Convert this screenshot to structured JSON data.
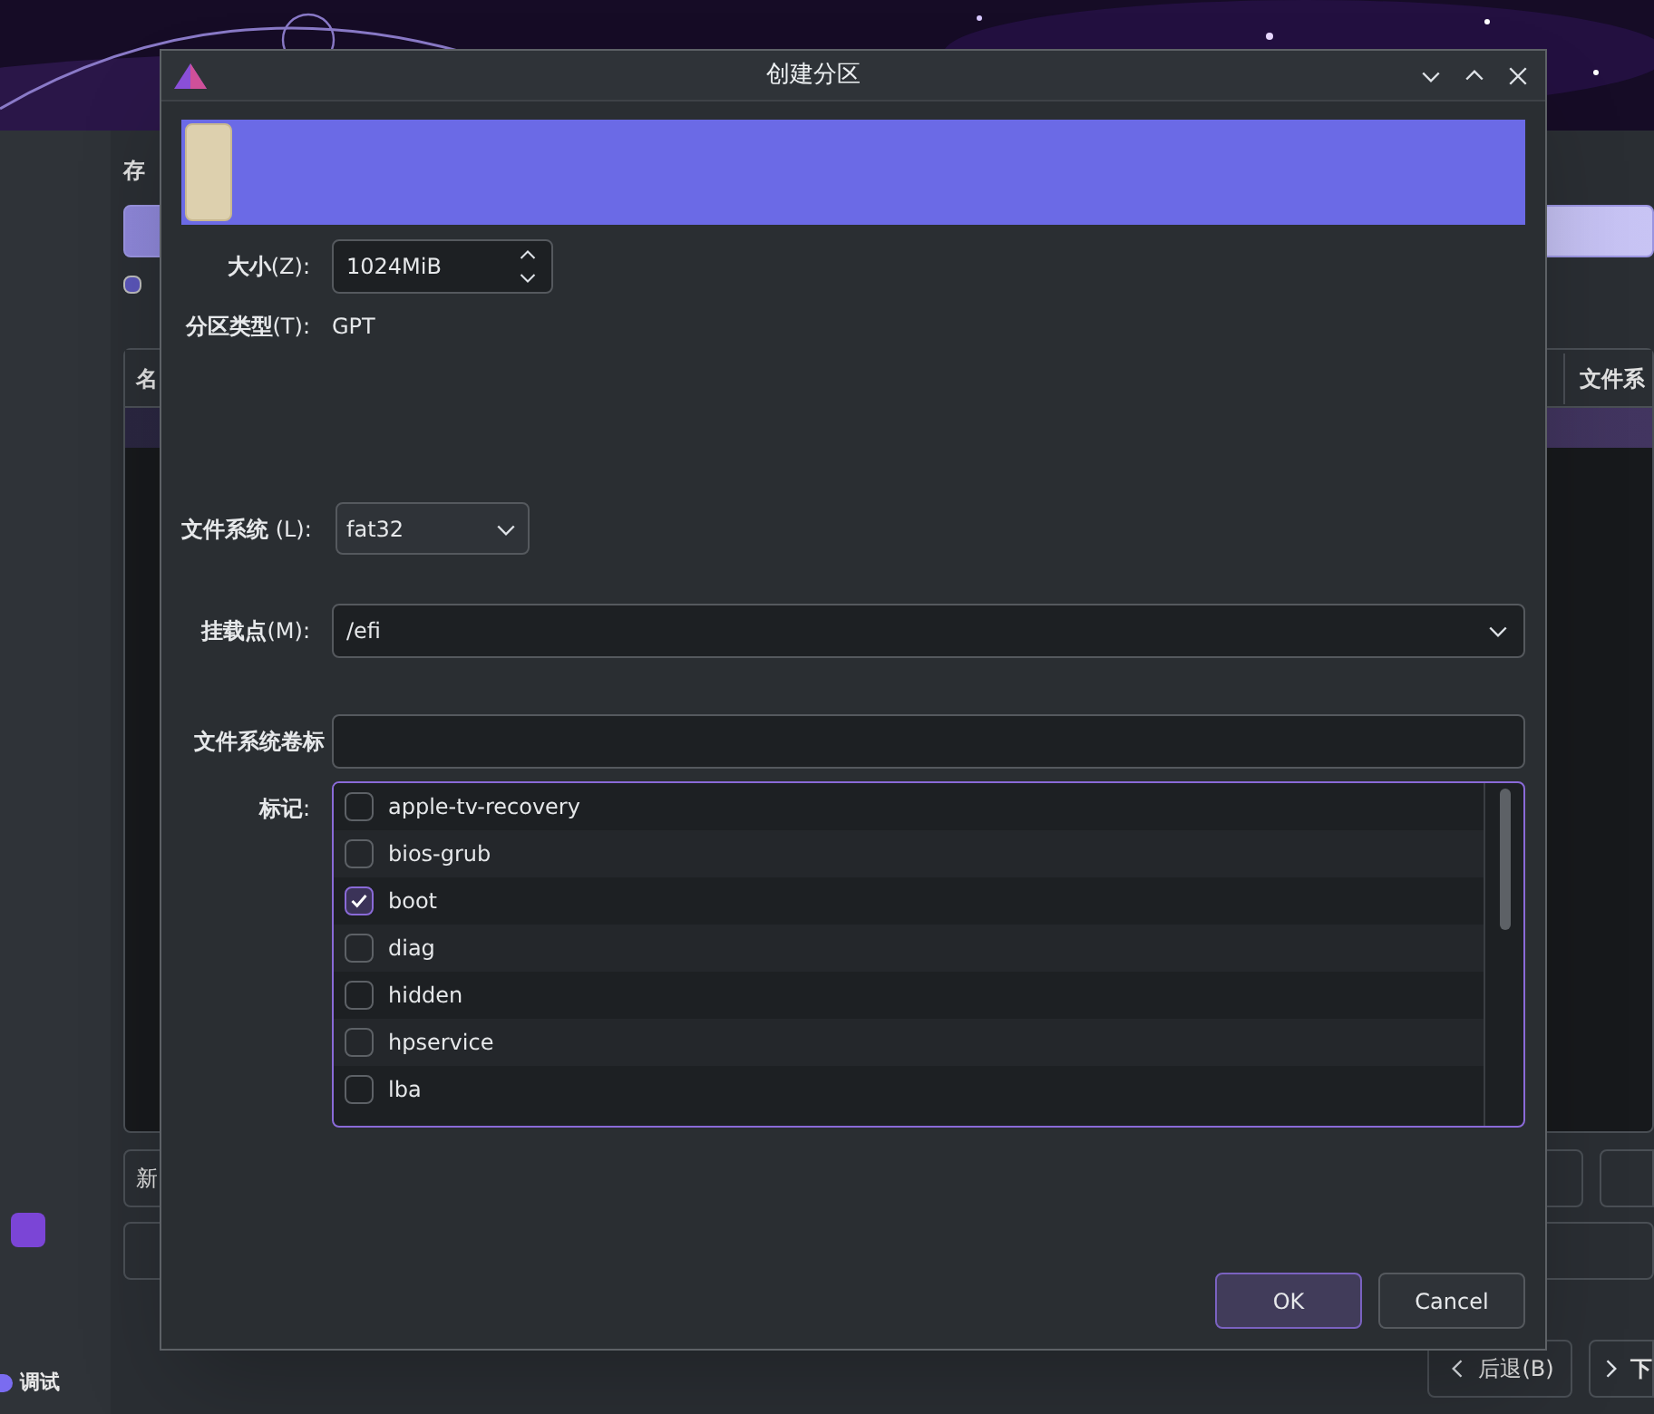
{
  "background_app": {
    "section_label": "存",
    "option_checked": true,
    "table": {
      "columns": [
        "名",
        "文件系"
      ]
    },
    "left_button": "新",
    "back_button": "后退(B)",
    "next_button": "下",
    "sidebar_item": "调试"
  },
  "dialog": {
    "title": "创建分区",
    "partition_bar": {
      "level": 0.035
    },
    "size": {
      "label": "**大小**(Z):",
      "value": "1024MiB"
    },
    "partition_type": {
      "label": "**分区类型**(T):",
      "value": "GPT"
    },
    "file_system": {
      "label": "**文件系统** (L):",
      "value": "fat32"
    },
    "mount_point": {
      "label": "**挂载点**(M):",
      "value": "/efi"
    },
    "volume_label": {
      "label": "**文件系统卷标**"
    },
    "flags": {
      "label": "**标记**:",
      "items": [
        {
          "label": "apple-tv-recovery",
          "checked": false
        },
        {
          "label": "bios-grub",
          "checked": false
        },
        {
          "label": "boot",
          "checked": true
        },
        {
          "label": "diag",
          "checked": false
        },
        {
          "label": "hidden",
          "checked": false
        },
        {
          "label": "hpservice",
          "checked": false
        },
        {
          "label": "lba",
          "checked": false
        }
      ]
    },
    "buttons": [
      {
        "label": "OK",
        "selected": true
      },
      {
        "label": "Cancel",
        "selected": false
      }
    ]
  }
}
